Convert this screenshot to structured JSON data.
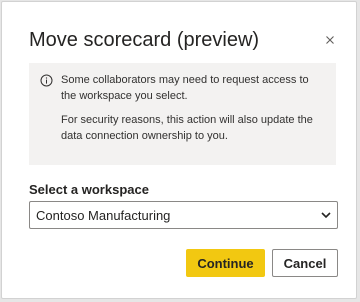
{
  "dialog": {
    "title": "Move scorecard (preview)",
    "info": {
      "line1": "Some collaborators may need to request access to the workspace you select.",
      "line2": "For security reasons, this action will also update the data connection ownership to you."
    },
    "workspace": {
      "label": "Select a workspace",
      "selected": "Contoso Manufacturing"
    },
    "buttons": {
      "continue": "Continue",
      "cancel": "Cancel"
    }
  },
  "colors": {
    "primary": "#f2c811",
    "panel": "#f3f2f1",
    "text": "#252423"
  },
  "icons": {
    "close": "close-icon",
    "info": "info-icon",
    "chevron": "chevron-down-icon"
  }
}
